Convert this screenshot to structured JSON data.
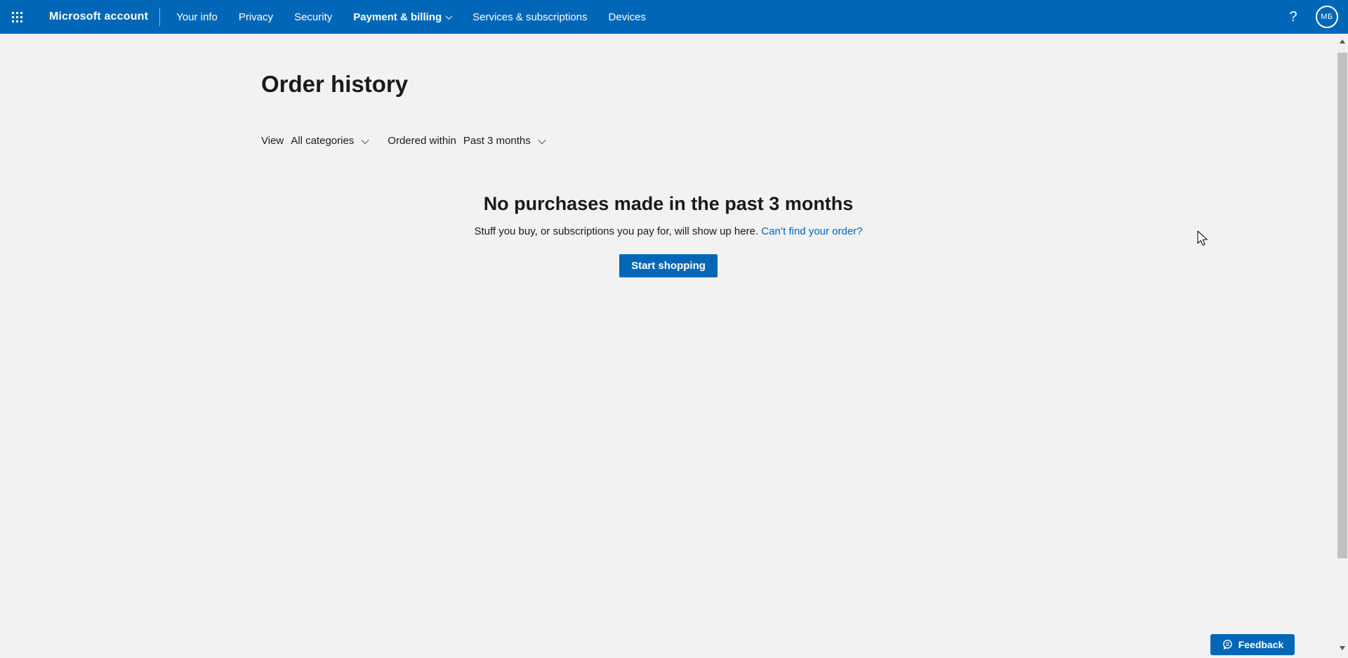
{
  "header": {
    "brand": "Microsoft account",
    "nav": [
      {
        "label": "Your info"
      },
      {
        "label": "Privacy"
      },
      {
        "label": "Security"
      },
      {
        "label": "Payment & billing"
      },
      {
        "label": "Services & subscriptions"
      },
      {
        "label": "Devices"
      }
    ],
    "help_label": "?",
    "avatar_initials": "МБ"
  },
  "page": {
    "title": "Order history",
    "filters": {
      "view_label": "View",
      "view_value": "All categories",
      "ordered_within_label": "Ordered within",
      "ordered_within_value": "Past 3 months"
    },
    "empty_state": {
      "title": "No purchases made in the past 3 months",
      "description": "Stuff you buy, or subscriptions you pay for, will show up here.",
      "link_text": "Can’t find your order?",
      "button_label": "Start shopping"
    }
  },
  "feedback": {
    "label": "Feedback"
  },
  "colors": {
    "header_background": "#0067b8",
    "accent": "#0067b8",
    "link": "#0067b8",
    "page_background": "#f2f2f2",
    "scrollbar_thumb": "#c1c1c1"
  }
}
